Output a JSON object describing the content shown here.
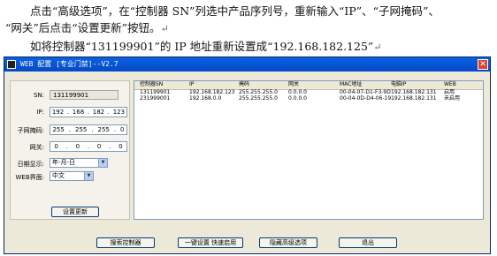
{
  "doc": {
    "line1": "点击“高级选项”，在“控制器 SN”列选中产品序列号，重新输入“IP”、“子网掩码”、",
    "line2": "“网关”后点击“设置更新”按钮。",
    "line3": "如将控制器“131199901”的 IP 地址重新设置成“192.168.182.125”",
    "para_mark": "↵"
  },
  "window": {
    "title": "WEB 配置 [专业门禁]--V2.7",
    "close_glyph": "✕"
  },
  "form": {
    "sn_label": "SN:",
    "sn_value": "131199901",
    "ip_label": "IP:",
    "ip": [
      "192",
      "168",
      "182",
      "123"
    ],
    "mask_label": "子网掩码:",
    "mask": [
      "255",
      "255",
      "255",
      "0"
    ],
    "gateway_label": "网关:",
    "gateway": [
      "0",
      "0",
      "0",
      "0"
    ],
    "date_label": "日期显示:",
    "date_value": "年-月-日",
    "web_label": "WEB界面:",
    "web_value": "中文",
    "update_button": "设置更新"
  },
  "table": {
    "columns": [
      "控制器SN",
      "IP",
      "掩码",
      "网关",
      "MAC地址",
      "电脑IP",
      "WEB"
    ],
    "rows": [
      [
        "131199901",
        "192.168.182.123",
        "255.255.255.0",
        "0.0.0.0",
        "00-04-07-D1-F3-9D",
        "192.168.182.131",
        "启用"
      ],
      [
        "231999001",
        "192.168.0.0",
        "255.255.255.0",
        "0.0.0.0",
        "00-04-0D-D4-06-19",
        "192.168.182.131",
        "未启用"
      ]
    ]
  },
  "footer": {
    "search_button": "搜索控制器",
    "quick_button": "一键设置 快速启用",
    "hide_button": "隐藏高级选项",
    "exit_button": "退出"
  },
  "colors": {
    "titlebar": "#0548c8",
    "window_bg": "#ece9d8",
    "selection": "#316ac5"
  }
}
